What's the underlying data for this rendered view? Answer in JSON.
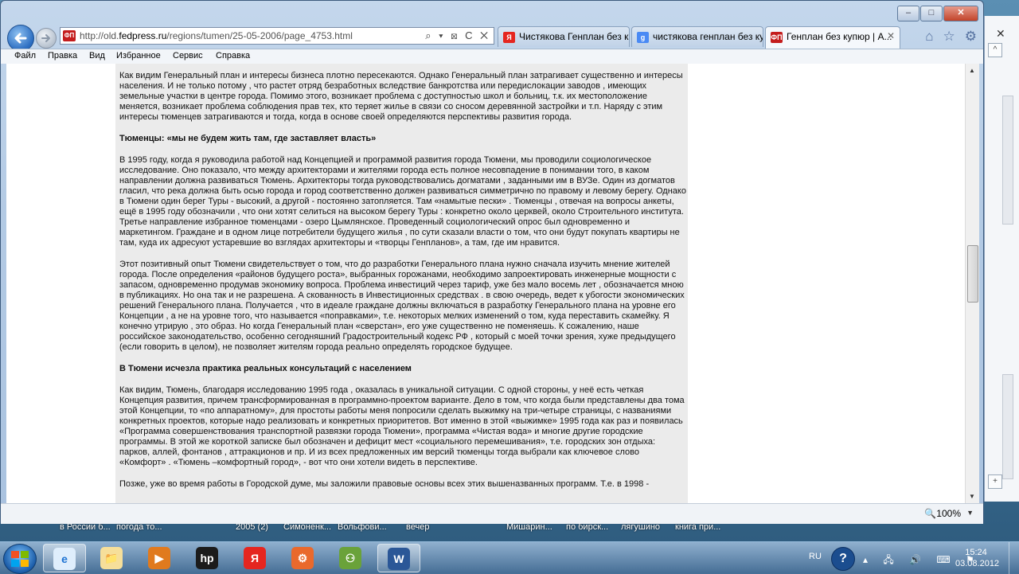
{
  "browser": {
    "url_prefix": "http://old.",
    "url_domain": "fedpress.ru",
    "url_path": "/regions/tumen/25-05-2006/page_4753.html",
    "address_tools": "⌕ ▾ ⊠ C ✕",
    "tabs": [
      {
        "label": "Чистякова Генплан без к...",
        "icon": "yandex-icon"
      },
      {
        "label": "чистякова генплан без ку...",
        "icon": "google-icon"
      },
      {
        "label": "Генплан без купюр | А...",
        "icon": "fedpress-icon",
        "active": true
      }
    ],
    "site_icon_text": "ФП",
    "tab_close": "✕",
    "zoom": "100%",
    "controls": {
      "minimize": "–",
      "maximize": "□",
      "close": "✕"
    }
  },
  "menu": [
    "Файл",
    "Правка",
    "Вид",
    "Избранное",
    "Сервис",
    "Справка"
  ],
  "article": {
    "p1": "Как видим Генеральный план и интересы бизнеса плотно пересекаются. Однако Генеральный план затрагивает существенно и интересы населения. И не только потому , что растет отряд безработных вследствие банкротства или передислокации заводов , имеющих земельные участки в центре города. Помимо этого, возникает проблема с доступностью школ и больниц, т.к. их местоположение меняется, возникает проблема соблюдения прав тех, кто теряет жилье в связи со сносом деревянной застройки и т.п. Наряду с этим интересы тюменцев затрагиваются и тогда, когда в основе своей определяются перспективы развития города.",
    "h1": "Тюменцы: «мы не будем жить там, где заставляет власть»",
    "p2": "В 1995 году, когда я руководила работой над Концепцией и программой развития города Тюмени, мы проводили социологическое исследование. Оно показало, что между архитекторами и жителями города есть полное несовпадение в понимании того, в каком направлении должна развиваться Тюмень. Архитекторы тогда руководствовались догматами , заданными им в ВУЗе. Один из догматов гласил, что река должна быть осью города и город соответственно должен развиваться симметрично по правому и левому берегу. Однако в Тюмени один берег Туры - высокий, а другой - постоянно затопляется. Там «намытые пески» . Тюменцы , отвечая на вопросы анкеты, ещё в 1995 году обозначили , что они хотят селиться на высоком берегу Туры : конкретно около церквей, около Строительного института. Третье направление избранное тюменцами - озеро Цымлянское. Проведенный социологический опрос был одновременно и маркетингом. Граждане и в одном лице потребители будущего жилья , по сути сказали власти о том, что они будут покупать квартиры не там, куда их адресуют устаревшие во взглядах архитекторы и «творцы Генпланов», а там, где им нравится.",
    "p3": "Этот позитивный опыт Тюмени свидетельствует о том, что до разработки Генерального плана нужно сначала изучить мнение жителей города. После определения «районов будущего роста», выбранных горожанами, необходимо запроектировать инженерные мощности с запасом, одновременно продумав экономику вопроса. Проблема инвестиций через тариф, уже без мало восемь лет , обозначается мною в публикациях. Но она так и не разрешена. А скованность в Инвестиционных средствах . в свою очередь, ведет к убогости экономических решений Генерального плана. Получается , что в идеале граждане должны включаться в разработку Генерального плана на уровне его Концепции , а не на уровне того, что называется «поправками», т.е. некоторых мелких изменений о том, куда переставить скамейку. Я конечно утрирую , это образ. Но когда Генеральный план «сверстан», его уже существенно не поменяешь. К сожалению, наше российское законодательство, особенно сегодняшний Градостроительный кодекс РФ , который с моей точки зрения, хуже предыдущего (если говорить в целом), не позволяет жителям города реально определять городское будущее.",
    "h2": "В Тюмени исчезла практика реальных консультаций с населением",
    "p4": "Как видим, Тюмень, благодаря исследованию 1995 года , оказалась в уникальной ситуации. С одной стороны, у неё есть четкая Концепция развития, причем трансформированная в программно-проектом варианте. Дело в том, что когда были представлены два тома этой Концепции, то «по аппаратному», для простоты работы меня попросили сделать выжимку на три-четыре страницы, с названиями конкретных проектов, которые надо реализовать и конкретных приоритетов. Вот именно в этой «выжимке» 1995 года как раз и появилась «Программа совершенствования транспортной развязки города Тюмени», программа «Чистая вода» и многие другие городские программы. В этой же короткой записке был обозначен и дефицит мест «социального перемешивания», т.е. городских зон отдыха: парков, аллей, фонтанов , аттракционов и пр. И из всех предложенных им версий тюменцы тогда выбрали как ключевое слово «Комфорт» . «Тюмень –комфортный город», - вот что они хотели видеть в перспективе.",
    "p5": "Позже, уже во время работы в Городской думе, мы заложили правовые основы всех этих вышеназванных программ. Т.е. в 1998 -"
  },
  "desktop_labels": [
    "в России б...",
    "погода то...",
    "2005 (2)",
    "Симоненк...",
    "Вольфови...",
    "вечер",
    "Мишарин...",
    "по бирск...",
    "лягушино",
    "книга при..."
  ],
  "background_window": {
    "close": "✕",
    "up": "^",
    "plus": "+"
  },
  "taskbar": {
    "lang": "RU",
    "help": "?",
    "tray_icons": "▴ 🖧 🔊 ⌨ ⚑",
    "time": "15:24",
    "date": "03.08.2012",
    "apps": [
      {
        "name": "ie",
        "label": "e",
        "color": "#1e73d2",
        "bg": "#dfeefc",
        "active": true
      },
      {
        "name": "explorer",
        "label": "📁",
        "color": "#c99a2e",
        "bg": "#f6df9a"
      },
      {
        "name": "media-player",
        "label": "▶",
        "color": "#fff",
        "bg": "#e07a1e"
      },
      {
        "name": "hp",
        "label": "hp",
        "color": "#fff",
        "bg": "#1b1b1b"
      },
      {
        "name": "yandex",
        "label": "Я",
        "color": "#fff",
        "bg": "#e52620"
      },
      {
        "name": "office-tool",
        "label": "⚙",
        "color": "#fff",
        "bg": "#e9692c"
      },
      {
        "name": "network",
        "label": "⚇",
        "color": "#fff",
        "bg": "#6aa23a"
      },
      {
        "name": "word",
        "label": "W",
        "color": "#fff",
        "bg": "#2b5797",
        "active": true
      }
    ]
  },
  "colors": {
    "article_bg": "#ebebeb",
    "accent": "#c41d1d"
  }
}
